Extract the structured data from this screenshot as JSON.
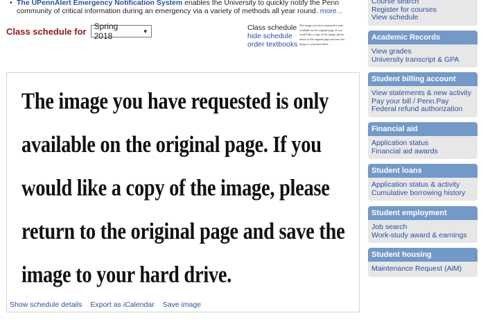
{
  "alert": {
    "title": "The UPennAlert Emergency Notification System",
    "text": " enables the University to quickly notify the Penn community of critical information during an emergency via a variety of methods all year round. ",
    "more": "more..."
  },
  "schedule": {
    "label": "Class schedule for",
    "term": "Spring 2018",
    "links": {
      "class_schedule": "Class schedule",
      "hide_schedule": "hide schedule",
      "order_textbooks": "order textbooks"
    },
    "thumbnail_lines": [
      "The image you have requested is only",
      "available on the original page. If you",
      "would like a copy of the image, please",
      "return to the original page and save the",
      "image to your hard drive."
    ],
    "message_lines": [
      "The image you have requested is only",
      "available on the original page. If you",
      "would like a copy of the image, please",
      "return to the original page and save the",
      "image to your hard drive."
    ],
    "footer_links": {
      "show_details": "Show schedule details",
      "export": "Export as iCalendar",
      "save": "Save image"
    }
  },
  "sidebar": {
    "top_links": [
      "Course search",
      "Register for courses",
      "View schedule"
    ],
    "boxes": [
      {
        "title": "Academic Records",
        "links": [
          "View grades",
          "University transcript & GPA"
        ]
      },
      {
        "title": "Student billing account",
        "links": [
          "View statements & new activity",
          "Pay your bill / Penn.Pay",
          "Federal refund authorization"
        ]
      },
      {
        "title": "Financial aid",
        "links": [
          "Application status",
          "Financial aid awards"
        ]
      },
      {
        "title": "Student loans",
        "links": [
          "Application status & activity",
          "Cumulative borrowing history"
        ]
      },
      {
        "title": "Student employment",
        "links": [
          "Job search",
          "Work-study award & earnings"
        ]
      },
      {
        "title": "Student housing",
        "links": [
          "Maintenance Request (AiM)"
        ]
      }
    ]
  },
  "colors": {
    "link": "#2a4fa0",
    "schedule_label": "#8b1a1a",
    "box_header": "#7399c8",
    "box_body": "#e7e7e7"
  }
}
